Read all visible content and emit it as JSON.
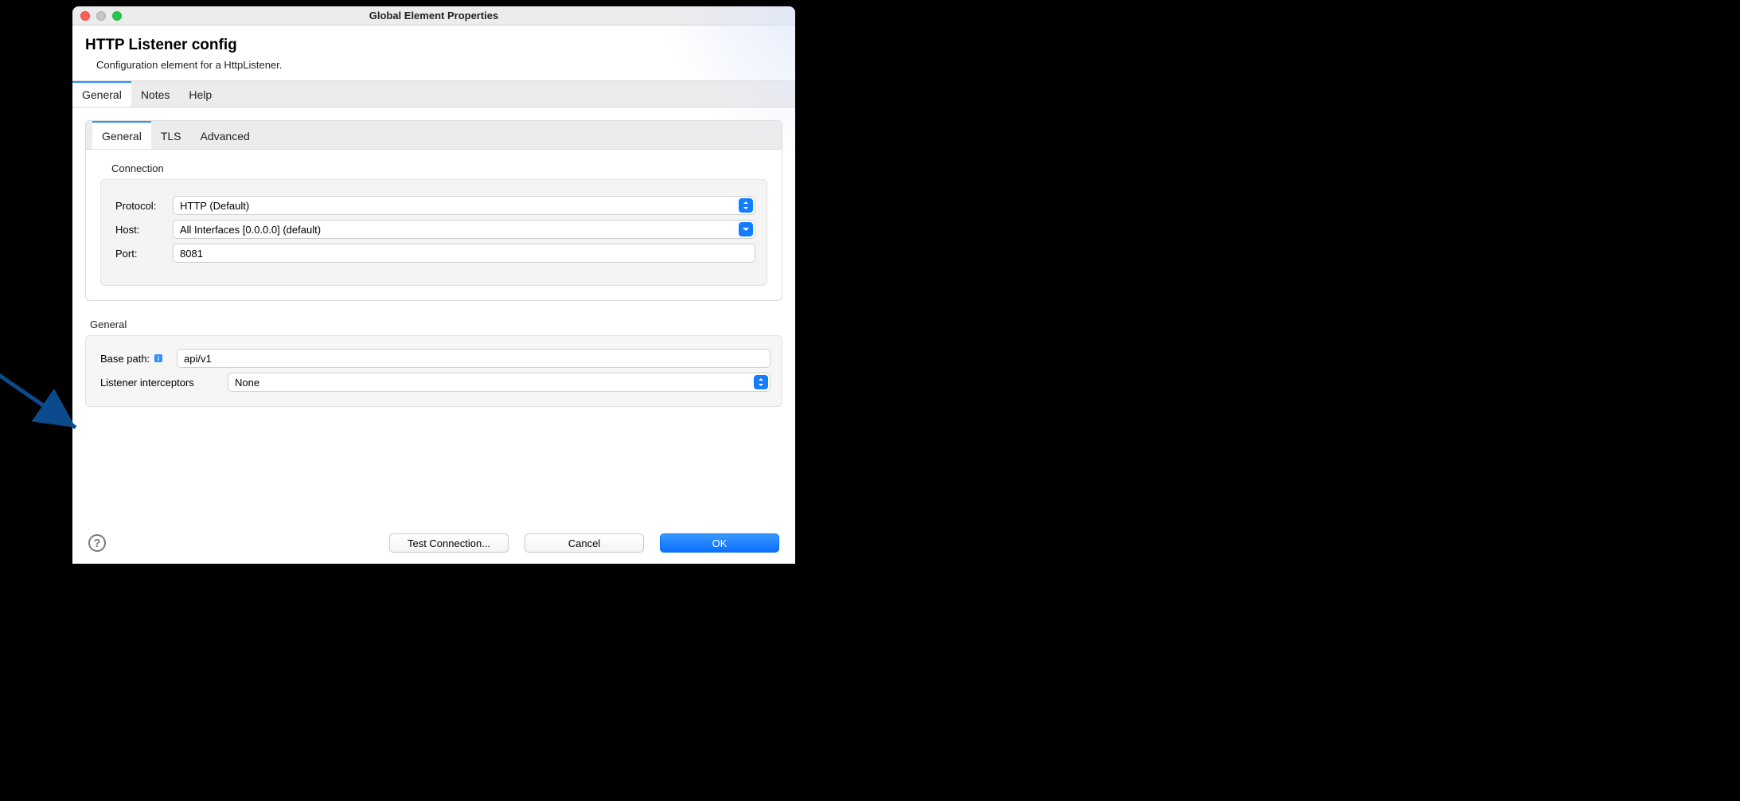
{
  "titlebar": {
    "title": "Global Element Properties"
  },
  "header": {
    "title": "HTTP Listener config",
    "subtitle": "Configuration element for a HttpListener."
  },
  "tabs": {
    "general": "General",
    "notes": "Notes",
    "help": "Help"
  },
  "inner_tabs": {
    "general": "General",
    "tls": "TLS",
    "advanced": "Advanced"
  },
  "connection": {
    "label": "Connection",
    "protocol_label": "Protocol:",
    "protocol_value": "HTTP (Default)",
    "host_label": "Host:",
    "host_value": "All Interfaces [0.0.0.0] (default)",
    "port_label": "Port:",
    "port_value": "8081"
  },
  "general2": {
    "label": "General",
    "base_path_label": "Base path:",
    "base_path_value": "api/v1",
    "interceptors_label": "Listener interceptors",
    "interceptors_value": "None"
  },
  "footer": {
    "test": "Test Connection...",
    "cancel": "Cancel",
    "ok": "OK"
  }
}
